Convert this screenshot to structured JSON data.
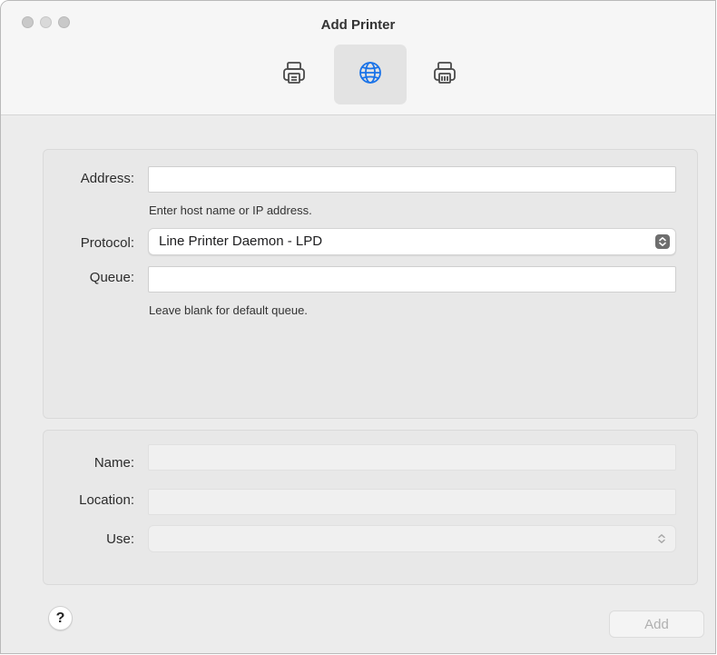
{
  "window": {
    "title": "Add Printer"
  },
  "toolbar": {
    "items": [
      {
        "icon": "printer-icon",
        "selected": false
      },
      {
        "icon": "globe-icon",
        "selected": true
      },
      {
        "icon": "printer-fax-icon",
        "selected": false
      }
    ],
    "accent": "#1a73e8"
  },
  "form": {
    "address": {
      "label": "Address:",
      "value": "",
      "hint": "Enter host name or IP address."
    },
    "protocol": {
      "label": "Protocol:",
      "value": "Line Printer Daemon - LPD"
    },
    "queue": {
      "label": "Queue:",
      "value": "",
      "hint": "Leave blank for default queue."
    }
  },
  "details": {
    "name": {
      "label": "Name:",
      "value": ""
    },
    "location": {
      "label": "Location:",
      "value": ""
    },
    "use": {
      "label": "Use:",
      "value": ""
    }
  },
  "footer": {
    "help_label": "?",
    "add_label": "Add"
  }
}
